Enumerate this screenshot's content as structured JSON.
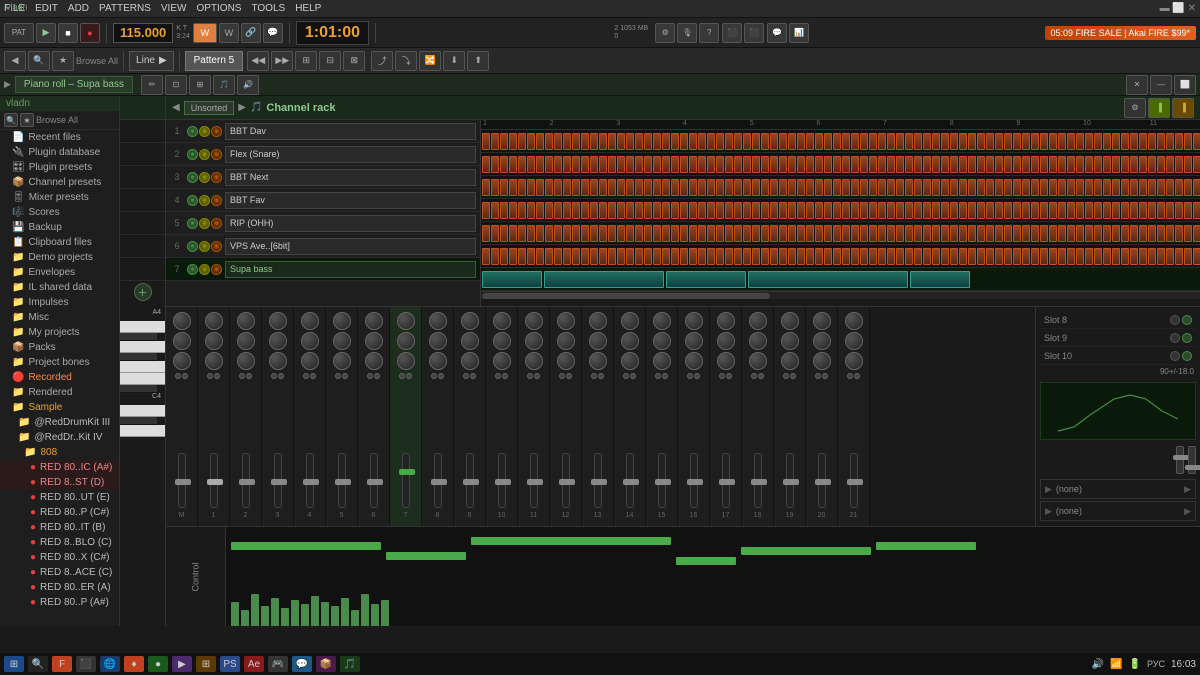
{
  "app": {
    "title": "FL Studio",
    "user": "vladn"
  },
  "menu": {
    "items": [
      "FILE",
      "EDIT",
      "ADD",
      "PATTERNS",
      "VIEW",
      "OPTIONS",
      "TOOLS",
      "HELP"
    ]
  },
  "toolbar": {
    "tempo": "115.000",
    "time": "1:01:00",
    "pattern": "Pattern 5",
    "mode": "Line",
    "play_label": "▶",
    "stop_label": "■",
    "record_label": "●",
    "fire_sale": "FIRE SALE | Akai FIRE",
    "fire_price": "$99*",
    "fire_time": "05:09"
  },
  "piano_roll": {
    "tab": "Piano roll – Supa bass"
  },
  "sidebar": {
    "user": "vladn",
    "items": [
      {
        "label": "Recent files",
        "icon": "📄",
        "type": "folder"
      },
      {
        "label": "Plugin database",
        "icon": "🔌",
        "type": "folder"
      },
      {
        "label": "Plugin presets",
        "icon": "🎛",
        "type": "folder"
      },
      {
        "label": "Channel presets",
        "icon": "📦",
        "type": "folder"
      },
      {
        "label": "Mixer presets",
        "icon": "🎚",
        "type": "folder"
      },
      {
        "label": "Scores",
        "icon": "🎼",
        "type": "folder"
      },
      {
        "label": "Backup",
        "icon": "💾",
        "type": "folder"
      },
      {
        "label": "Clipboard files",
        "icon": "📋",
        "type": "folder"
      },
      {
        "label": "Demo projects",
        "icon": "📁",
        "type": "folder"
      },
      {
        "label": "Envelopes",
        "icon": "📁",
        "type": "folder"
      },
      {
        "label": "IL shared data",
        "icon": "📁",
        "type": "folder"
      },
      {
        "label": "Impulses",
        "icon": "📁",
        "type": "folder"
      },
      {
        "label": "Misc",
        "icon": "📁",
        "type": "folder"
      },
      {
        "label": "My projects",
        "icon": "📁",
        "type": "folder"
      },
      {
        "label": "Packs",
        "icon": "📦",
        "type": "folder"
      },
      {
        "label": "Project bones",
        "icon": "📁",
        "type": "folder"
      },
      {
        "label": "Recorded",
        "icon": "🔴",
        "type": "folder"
      },
      {
        "label": "Rendered",
        "icon": "📁",
        "type": "folder"
      },
      {
        "label": "Sample",
        "icon": "📁",
        "type": "folder",
        "expanded": true
      },
      {
        "label": "@RedDrumKit III",
        "icon": "📁",
        "type": "subfolder"
      },
      {
        "label": "@RedDr..Kit IV",
        "icon": "📁",
        "type": "subfolder"
      },
      {
        "label": "808",
        "icon": "📁",
        "type": "subfolder2"
      },
      {
        "label": "RED 80..IC (A#)",
        "icon": "🔴",
        "type": "file",
        "selected": true
      },
      {
        "label": "RED 8..ST (D)",
        "icon": "🔴",
        "type": "file",
        "selected": true
      },
      {
        "label": "RED 80..UT (E)",
        "icon": "🔴",
        "type": "file"
      },
      {
        "label": "RED 80..P (C#)",
        "icon": "🔴",
        "type": "file"
      },
      {
        "label": "RED 80..IT (B)",
        "icon": "🔴",
        "type": "file"
      },
      {
        "label": "RED 8..BLO (C)",
        "icon": "🔴",
        "type": "file"
      },
      {
        "label": "RED 80..X (C#)",
        "icon": "🔴",
        "type": "file"
      },
      {
        "label": "RED 8..ACE (C)",
        "icon": "🔴",
        "type": "file"
      },
      {
        "label": "RED 80..ER (A)",
        "icon": "🔴",
        "type": "file"
      },
      {
        "label": "RED 80..P (A#)",
        "icon": "🔴",
        "type": "file"
      }
    ]
  },
  "channel_rack": {
    "title": "Channel rack",
    "dropdown": "Unsorted",
    "tracks": [
      {
        "num": 1,
        "name": "BBT Dav",
        "color": "#c05020"
      },
      {
        "num": 2,
        "name": "Flex (Snare)",
        "color": "#c05020"
      },
      {
        "num": 3,
        "name": "BBT Next",
        "color": "#c05020"
      },
      {
        "num": 4,
        "name": "BBT Fav",
        "color": "#c05020"
      },
      {
        "num": 5,
        "name": "RIP (OHH)",
        "color": "#c05020"
      },
      {
        "num": 6,
        "name": "VPS Ave..[6bit]",
        "color": "#c05020"
      },
      {
        "num": 7,
        "name": "Supa bass",
        "color": "#207060"
      }
    ]
  },
  "mixer": {
    "slots": [
      "Slot 8",
      "Slot 9",
      "Slot 10"
    ],
    "send_label1": "(none)",
    "send_label2": "(none)",
    "volume_db": "90+/-18.0"
  },
  "control_bar": {
    "label": "Control"
  },
  "taskbar": {
    "time": "16:03",
    "lang": "РУС"
  }
}
